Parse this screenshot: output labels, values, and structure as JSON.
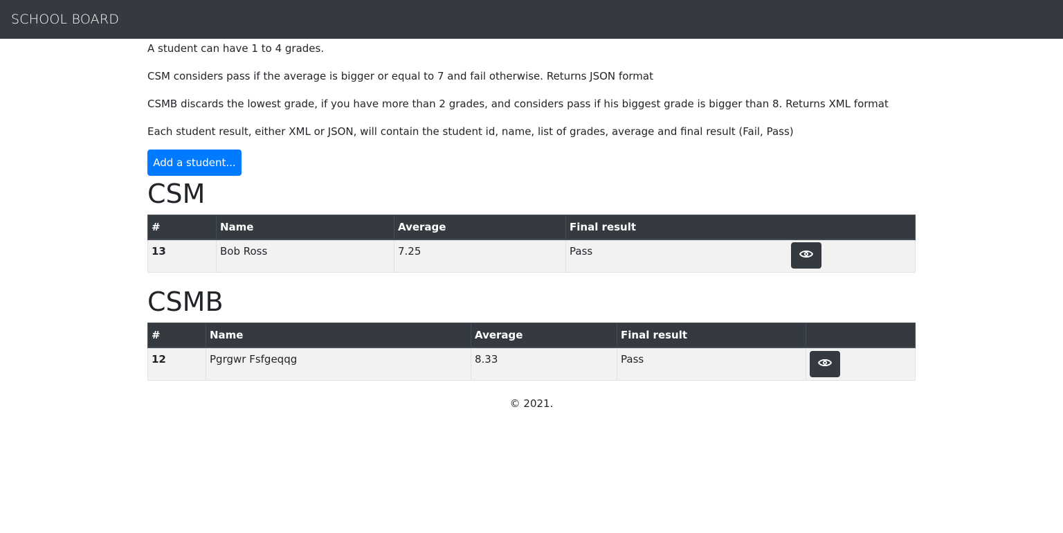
{
  "navbar": {
    "brand": "SCHOOL BOARD"
  },
  "intro": [
    "A student can have 1 to 4 grades.",
    "CSM considers pass if the average is bigger or equal to 7 and fail otherwise. Returns JSON format",
    "CSMB discards the lowest grade, if you have more than 2 grades, and considers pass if his biggest grade is bigger than 8. Returns XML format",
    "Each student result, either XML or JSON, will contain the student id, name, list of grades, average and final result (Fail, Pass)"
  ],
  "add_button": "Add a student...",
  "csm": {
    "title": "CSM",
    "headers": [
      "#",
      "Name",
      "Average",
      "Final result"
    ],
    "rows": [
      {
        "id": "13",
        "name": "Bob Ross",
        "average": "7.25",
        "result": "Pass",
        "action_icon": "eye-icon"
      }
    ]
  },
  "csmb": {
    "title": "CSMB",
    "headers": [
      "#",
      "Name",
      "Average",
      "Final result",
      ""
    ],
    "rows": [
      {
        "id": "12",
        "name": "Pgrgwr Fsfgeqqg",
        "average": "8.33",
        "result": "Pass",
        "action_icon": "eye-icon"
      }
    ]
  },
  "footer": "© 2021.",
  "colors": {
    "navbar": "#343a40",
    "primary": "#007bff",
    "row_bg": "#f2f2f2"
  }
}
